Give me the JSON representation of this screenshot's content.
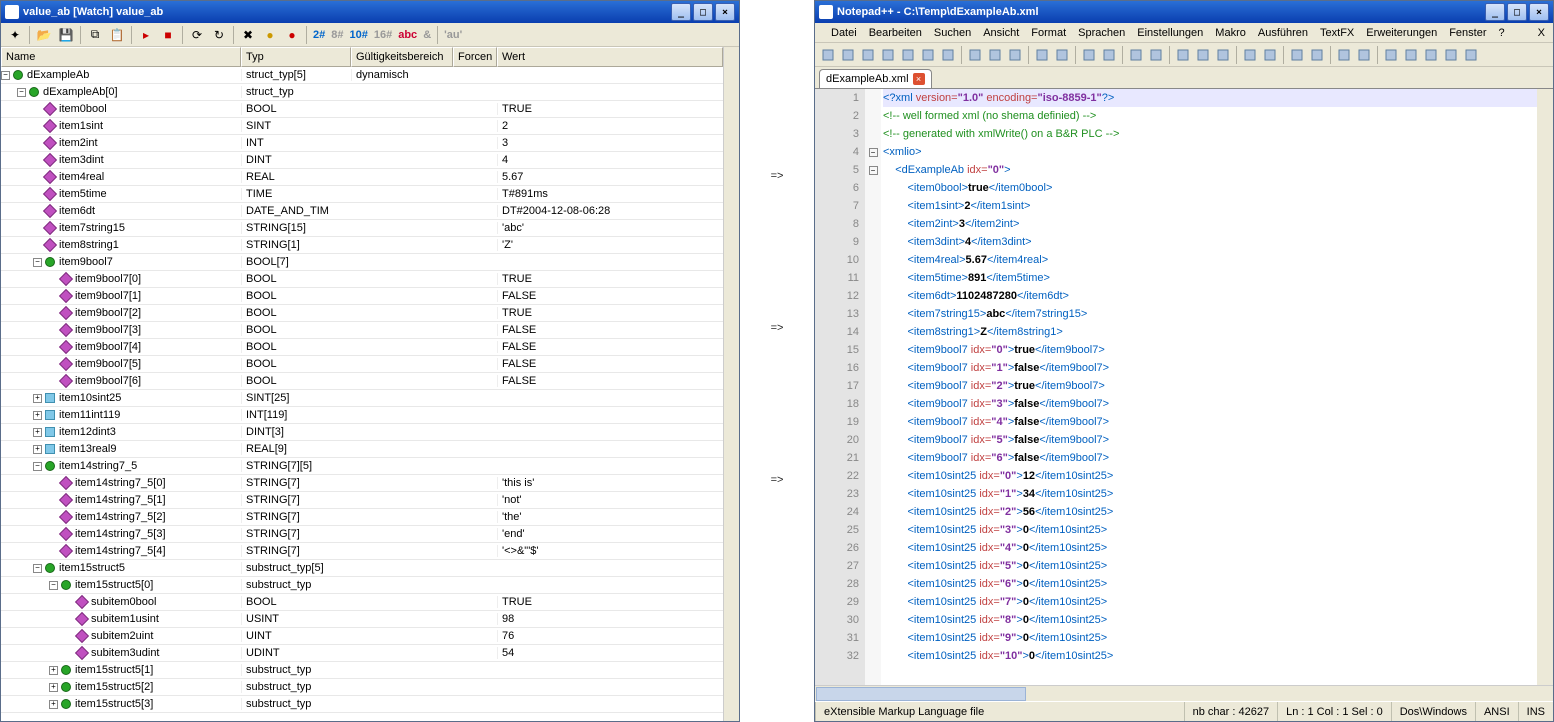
{
  "watch": {
    "title": "value_ab [Watch] value_ab",
    "toolbar_nums": {
      "n2": "2#",
      "n8": "8#",
      "n10": "10#",
      "n16": "16#",
      "abc": "abc",
      "amp": "&",
      "au": "'au'"
    },
    "cols": {
      "name": "Name",
      "typ": "Typ",
      "gul": "Gültigkeitsbereich",
      "for": "Forcen",
      "wert": "Wert"
    },
    "rows": [
      {
        "d": 0,
        "exp": "-",
        "ico": "s",
        "name": "dExampleAb",
        "typ": "struct_typ[5]",
        "gul": "dynamisch",
        "wert": ""
      },
      {
        "d": 1,
        "exp": "-",
        "ico": "s",
        "name": "dExampleAb[0]",
        "typ": "struct_typ",
        "wert": ""
      },
      {
        "d": 2,
        "exp": "",
        "ico": "v",
        "name": "item0bool",
        "typ": "BOOL",
        "wert": "TRUE"
      },
      {
        "d": 2,
        "exp": "",
        "ico": "v",
        "name": "item1sint",
        "typ": "SINT",
        "wert": "2"
      },
      {
        "d": 2,
        "exp": "",
        "ico": "v",
        "name": "item2int",
        "typ": "INT",
        "wert": "3"
      },
      {
        "d": 2,
        "exp": "",
        "ico": "v",
        "name": "item3dint",
        "typ": "DINT",
        "wert": "4"
      },
      {
        "d": 2,
        "exp": "",
        "ico": "v",
        "name": "item4real",
        "typ": "REAL",
        "wert": "5.67"
      },
      {
        "d": 2,
        "exp": "",
        "ico": "v",
        "name": "item5time",
        "typ": "TIME",
        "wert": "T#891ms"
      },
      {
        "d": 2,
        "exp": "",
        "ico": "v",
        "name": "item6dt",
        "typ": "DATE_AND_TIM",
        "wert": "DT#2004-12-08-06:28"
      },
      {
        "d": 2,
        "exp": "",
        "ico": "v",
        "name": "item7string15",
        "typ": "STRING[15]",
        "wert": "'abc'"
      },
      {
        "d": 2,
        "exp": "",
        "ico": "v",
        "name": "item8string1",
        "typ": "STRING[1]",
        "wert": "'Z'"
      },
      {
        "d": 2,
        "exp": "-",
        "ico": "s",
        "name": "item9bool7",
        "typ": "BOOL[7]",
        "wert": ""
      },
      {
        "d": 3,
        "exp": "",
        "ico": "v",
        "name": "item9bool7[0]",
        "typ": "BOOL",
        "wert": "TRUE"
      },
      {
        "d": 3,
        "exp": "",
        "ico": "v",
        "name": "item9bool7[1]",
        "typ": "BOOL",
        "wert": "FALSE"
      },
      {
        "d": 3,
        "exp": "",
        "ico": "v",
        "name": "item9bool7[2]",
        "typ": "BOOL",
        "wert": "TRUE"
      },
      {
        "d": 3,
        "exp": "",
        "ico": "v",
        "name": "item9bool7[3]",
        "typ": "BOOL",
        "wert": "FALSE"
      },
      {
        "d": 3,
        "exp": "",
        "ico": "v",
        "name": "item9bool7[4]",
        "typ": "BOOL",
        "wert": "FALSE"
      },
      {
        "d": 3,
        "exp": "",
        "ico": "v",
        "name": "item9bool7[5]",
        "typ": "BOOL",
        "wert": "FALSE"
      },
      {
        "d": 3,
        "exp": "",
        "ico": "v",
        "name": "item9bool7[6]",
        "typ": "BOOL",
        "wert": "FALSE"
      },
      {
        "d": 2,
        "exp": "+",
        "ico": "a",
        "name": "item10sint25",
        "typ": "SINT[25]",
        "wert": ""
      },
      {
        "d": 2,
        "exp": "+",
        "ico": "a",
        "name": "item11int119",
        "typ": "INT[119]",
        "wert": ""
      },
      {
        "d": 2,
        "exp": "+",
        "ico": "a",
        "name": "item12dint3",
        "typ": "DINT[3]",
        "wert": ""
      },
      {
        "d": 2,
        "exp": "+",
        "ico": "a",
        "name": "item13real9",
        "typ": "REAL[9]",
        "wert": ""
      },
      {
        "d": 2,
        "exp": "-",
        "ico": "s",
        "name": "item14string7_5",
        "typ": "STRING[7][5]",
        "wert": ""
      },
      {
        "d": 3,
        "exp": "",
        "ico": "v",
        "name": "item14string7_5[0]",
        "typ": "STRING[7]",
        "wert": "'this is'"
      },
      {
        "d": 3,
        "exp": "",
        "ico": "v",
        "name": "item14string7_5[1]",
        "typ": "STRING[7]",
        "wert": "'not'"
      },
      {
        "d": 3,
        "exp": "",
        "ico": "v",
        "name": "item14string7_5[2]",
        "typ": "STRING[7]",
        "wert": "'the'"
      },
      {
        "d": 3,
        "exp": "",
        "ico": "v",
        "name": "item14string7_5[3]",
        "typ": "STRING[7]",
        "wert": "'end'"
      },
      {
        "d": 3,
        "exp": "",
        "ico": "v",
        "name": "item14string7_5[4]",
        "typ": "STRING[7]",
        "wert": "'<>&\"'$'"
      },
      {
        "d": 2,
        "exp": "-",
        "ico": "s",
        "name": "item15struct5",
        "typ": "substruct_typ[5]",
        "wert": ""
      },
      {
        "d": 3,
        "exp": "-",
        "ico": "s",
        "name": "item15struct5[0]",
        "typ": "substruct_typ",
        "wert": ""
      },
      {
        "d": 4,
        "exp": "",
        "ico": "v",
        "name": "subitem0bool",
        "typ": "BOOL",
        "wert": "TRUE"
      },
      {
        "d": 4,
        "exp": "",
        "ico": "v",
        "name": "subitem1usint",
        "typ": "USINT",
        "wert": "98"
      },
      {
        "d": 4,
        "exp": "",
        "ico": "v",
        "name": "subitem2uint",
        "typ": "UINT",
        "wert": "76"
      },
      {
        "d": 4,
        "exp": "",
        "ico": "v",
        "name": "subitem3udint",
        "typ": "UDINT",
        "wert": "54"
      },
      {
        "d": 3,
        "exp": "+",
        "ico": "s",
        "name": "item15struct5[1]",
        "typ": "substruct_typ",
        "wert": ""
      },
      {
        "d": 3,
        "exp": "+",
        "ico": "s",
        "name": "item15struct5[2]",
        "typ": "substruct_typ",
        "wert": ""
      },
      {
        "d": 3,
        "exp": "+",
        "ico": "s",
        "name": "item15struct5[3]",
        "typ": "substruct_typ",
        "wert": ""
      }
    ]
  },
  "arrows": [
    "=>",
    "=>",
    "=>"
  ],
  "npp": {
    "title": "Notepad++ - C:\\Temp\\dExampleAb.xml",
    "menu": [
      "Datei",
      "Bearbeiten",
      "Suchen",
      "Ansicht",
      "Format",
      "Sprachen",
      "Einstellungen",
      "Makro",
      "Ausführen",
      "TextFX",
      "Erweiterungen",
      "Fenster",
      "?"
    ],
    "menu_close": "X",
    "tab": "dExampleAb.xml",
    "lines": [
      {
        "n": 1,
        "t": "pi",
        "c": "<?xml version=\"1.0\" encoding=\"iso-8859-1\"?>",
        "hl": true
      },
      {
        "n": 2,
        "t": "cmt",
        "c": "<!-- well formed xml (no shema definied) -->"
      },
      {
        "n": 3,
        "t": "cmt",
        "c": "<!-- generated with xmlWrite() on a B&R PLC -->"
      },
      {
        "n": 4,
        "t": "tag",
        "c": "<xmlio>",
        "fold": "-"
      },
      {
        "n": 5,
        "t": "tagattr",
        "tag": "dExampleAb",
        "attr": "idx",
        "val": "0",
        "fold": "-",
        "i": 1
      },
      {
        "n": 6,
        "t": "elem",
        "tag": "item0bool",
        "txt": "true",
        "i": 2
      },
      {
        "n": 7,
        "t": "elem",
        "tag": "item1sint",
        "txt": "2",
        "i": 2
      },
      {
        "n": 8,
        "t": "elem",
        "tag": "item2int",
        "txt": "3",
        "i": 2
      },
      {
        "n": 9,
        "t": "elem",
        "tag": "item3dint",
        "txt": "4",
        "i": 2
      },
      {
        "n": 10,
        "t": "elem",
        "tag": "item4real",
        "txt": "5.67",
        "i": 2
      },
      {
        "n": 11,
        "t": "elem",
        "tag": "item5time",
        "txt": "891",
        "i": 2
      },
      {
        "n": 12,
        "t": "elem",
        "tag": "item6dt",
        "txt": "1102487280",
        "i": 2
      },
      {
        "n": 13,
        "t": "elem",
        "tag": "item7string15",
        "txt": "abc",
        "i": 2
      },
      {
        "n": 14,
        "t": "elem",
        "tag": "item8string1",
        "txt": "Z",
        "i": 2
      },
      {
        "n": 15,
        "t": "elemattr",
        "tag": "item9bool7",
        "attr": "idx",
        "val": "0",
        "txt": "true",
        "i": 2
      },
      {
        "n": 16,
        "t": "elemattr",
        "tag": "item9bool7",
        "attr": "idx",
        "val": "1",
        "txt": "false",
        "i": 2
      },
      {
        "n": 17,
        "t": "elemattr",
        "tag": "item9bool7",
        "attr": "idx",
        "val": "2",
        "txt": "true",
        "i": 2
      },
      {
        "n": 18,
        "t": "elemattr",
        "tag": "item9bool7",
        "attr": "idx",
        "val": "3",
        "txt": "false",
        "i": 2
      },
      {
        "n": 19,
        "t": "elemattr",
        "tag": "item9bool7",
        "attr": "idx",
        "val": "4",
        "txt": "false",
        "i": 2
      },
      {
        "n": 20,
        "t": "elemattr",
        "tag": "item9bool7",
        "attr": "idx",
        "val": "5",
        "txt": "false",
        "i": 2
      },
      {
        "n": 21,
        "t": "elemattr",
        "tag": "item9bool7",
        "attr": "idx",
        "val": "6",
        "txt": "false",
        "i": 2
      },
      {
        "n": 22,
        "t": "elemattr",
        "tag": "item10sint25",
        "attr": "idx",
        "val": "0",
        "txt": "12",
        "i": 2
      },
      {
        "n": 23,
        "t": "elemattr",
        "tag": "item10sint25",
        "attr": "idx",
        "val": "1",
        "txt": "34",
        "i": 2
      },
      {
        "n": 24,
        "t": "elemattr",
        "tag": "item10sint25",
        "attr": "idx",
        "val": "2",
        "txt": "56",
        "i": 2
      },
      {
        "n": 25,
        "t": "elemattr",
        "tag": "item10sint25",
        "attr": "idx",
        "val": "3",
        "txt": "0",
        "i": 2
      },
      {
        "n": 26,
        "t": "elemattr",
        "tag": "item10sint25",
        "attr": "idx",
        "val": "4",
        "txt": "0",
        "i": 2
      },
      {
        "n": 27,
        "t": "elemattr",
        "tag": "item10sint25",
        "attr": "idx",
        "val": "5",
        "txt": "0",
        "i": 2
      },
      {
        "n": 28,
        "t": "elemattr",
        "tag": "item10sint25",
        "attr": "idx",
        "val": "6",
        "txt": "0",
        "i": 2
      },
      {
        "n": 29,
        "t": "elemattr",
        "tag": "item10sint25",
        "attr": "idx",
        "val": "7",
        "txt": "0",
        "i": 2
      },
      {
        "n": 30,
        "t": "elemattr",
        "tag": "item10sint25",
        "attr": "idx",
        "val": "8",
        "txt": "0",
        "i": 2
      },
      {
        "n": 31,
        "t": "elemattr",
        "tag": "item10sint25",
        "attr": "idx",
        "val": "9",
        "txt": "0",
        "i": 2
      },
      {
        "n": 32,
        "t": "elemattr",
        "tag": "item10sint25",
        "attr": "idx",
        "val": "10",
        "txt": "0",
        "i": 2
      }
    ],
    "status": {
      "lang": "eXtensible Markup Language file",
      "chars": "nb char : 42627",
      "pos": "Ln : 1   Col : 1   Sel : 0",
      "eol": "Dos\\Windows",
      "enc": "ANSI",
      "ins": "INS"
    }
  }
}
